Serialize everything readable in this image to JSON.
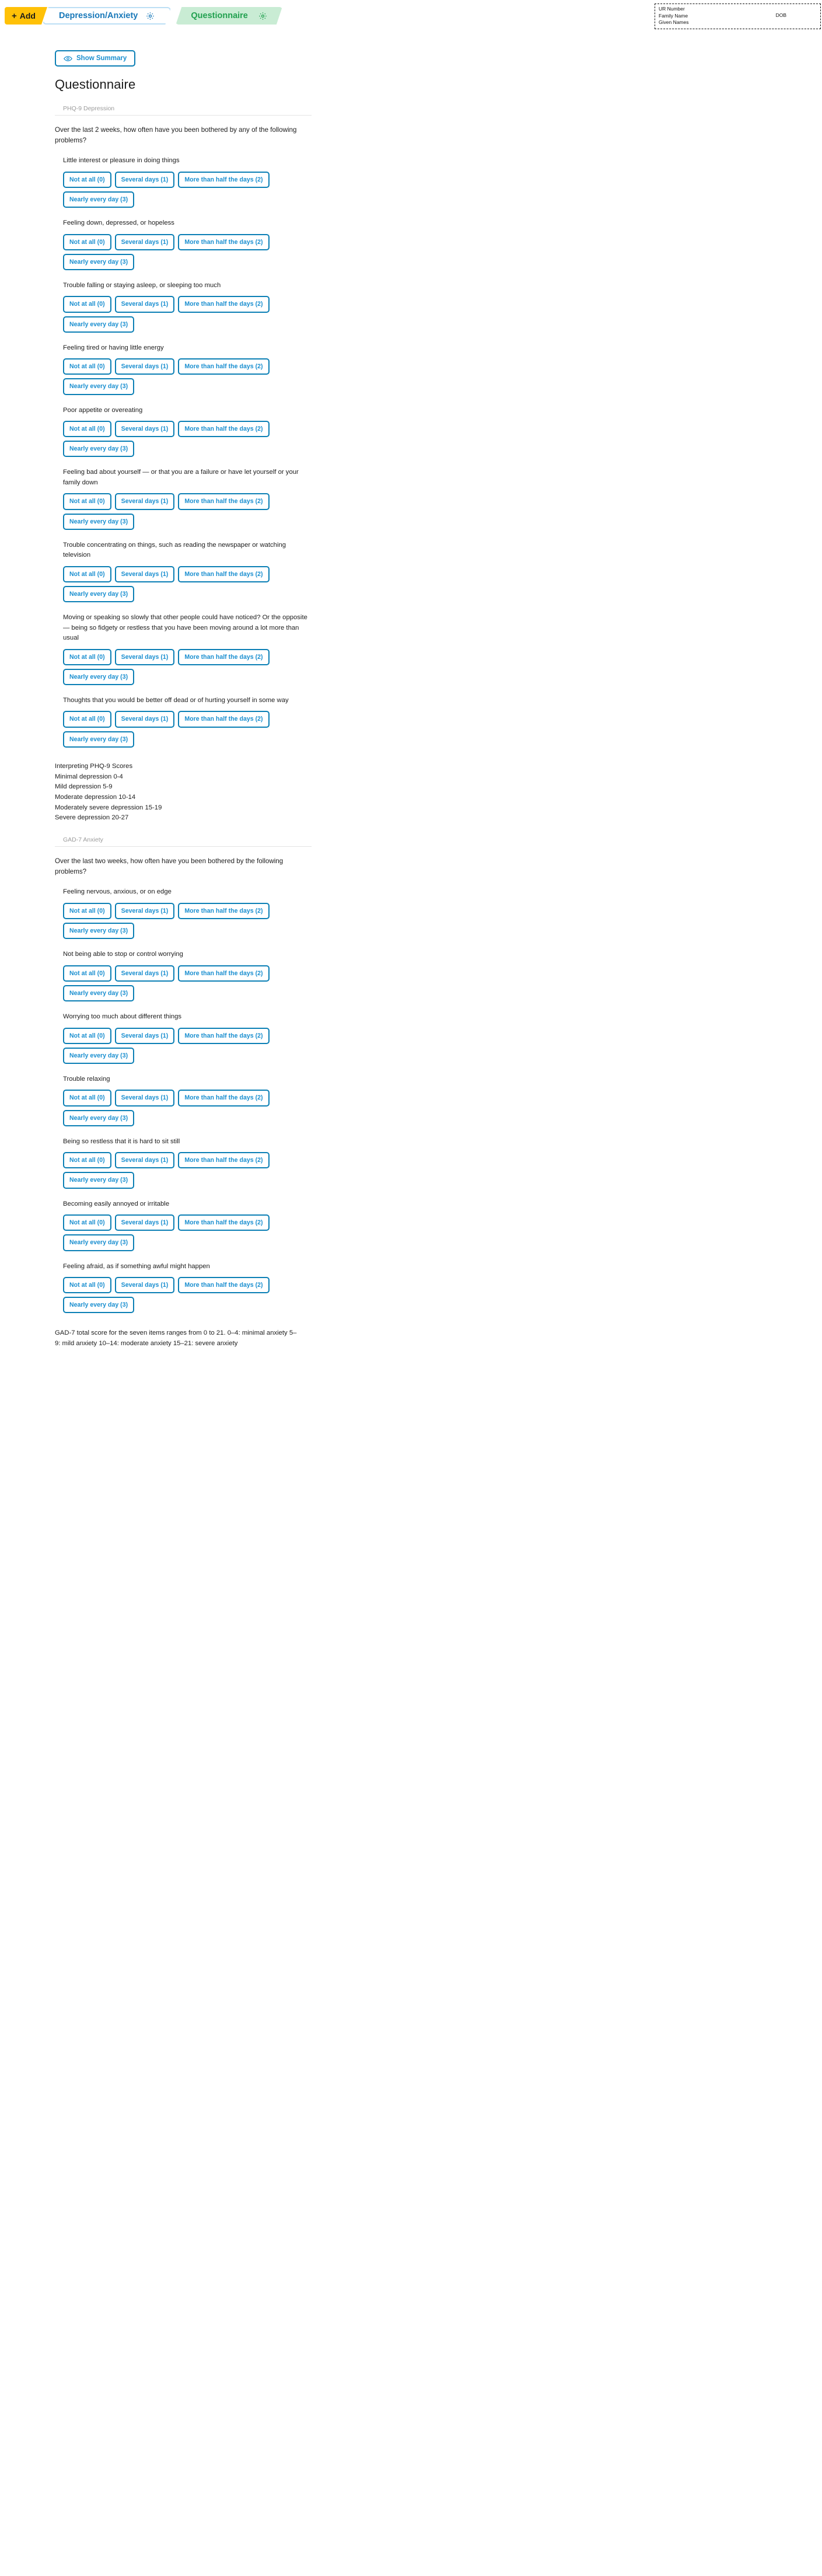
{
  "tabs": [
    {
      "label": "+ Add",
      "name": "add-tab",
      "plus": "+",
      "text": "Add",
      "icon": null
    },
    {
      "label": "Depression/Anxiety",
      "name": "tab-depression-anxiety",
      "icon": "gear-icon"
    },
    {
      "label": "Questionnaire",
      "name": "tab-questionnaire",
      "icon": "gear-icon"
    }
  ],
  "patient_banner": {
    "ur_number": "UR Number",
    "family_name": "Family Name",
    "given_names": "Given Names",
    "dob": "DOB"
  },
  "toolbar": {
    "show_summary_label": "Show Summary",
    "show_summary_icon": "eye-icon"
  },
  "page_title": "Questionnaire",
  "options": {
    "not_at_all": "Not at all (0)",
    "several_days": "Several days (1)",
    "more_than_half": "More than half the days (2)",
    "nearly_every_day": "Nearly every day (3)"
  },
  "phq9": {
    "section_label": "PHQ-9 Depression",
    "intro": "Over the last 2 weeks, how often have you been bothered by any of the following problems?",
    "questions": [
      "Little interest or pleasure in doing things",
      "Feeling down, depressed, or hopeless",
      "Trouble falling or staying asleep, or sleeping too much",
      "Feeling tired or having little energy",
      "Poor appetite or overeating",
      "Feeling bad about yourself — or that you are a failure or have let yourself or your family down",
      "Trouble concentrating on things, such as reading the newspaper or watching television",
      "Moving or speaking so slowly that other people could have noticed? Or the opposite — being so fidgety or restless that you have been moving around a lot more than usual",
      "Thoughts that you would be better off dead or of hurting yourself in some way"
    ],
    "interpretation": [
      "Interpreting PHQ-9 Scores",
      "Minimal depression 0-4",
      "Mild depression 5-9",
      "Moderate depression 10-14",
      "Moderately severe depression 15-19",
      "Severe depression 20-27"
    ]
  },
  "gad7": {
    "section_label": "GAD-7 Anxiety",
    "intro": "Over the last two weeks, how often have you been bothered by the following problems?",
    "questions": [
      "Feeling nervous, anxious, or on edge",
      "Not being able to stop or control worrying",
      "Worrying too much about different things",
      "Trouble relaxing",
      "Being so restless that it is hard to sit still",
      "Becoming easily annoyed or irritable",
      "Feeling afraid, as if something awful might happen"
    ],
    "footnote": "GAD-7 total score for the seven items ranges from 0 to 21. 0–4: minimal anxiety 5–9: mild anxiety 10–14: moderate anxiety 15–21: severe anxiety"
  },
  "colors": {
    "accent_blue": "#1a8fd0",
    "border_blue": "#0b7fb5",
    "tab_yellow": "#ffc107",
    "tab_green_bg": "#c9ecd4",
    "tab_green_text": "#21a04f",
    "muted_grey": "#9b9b9b"
  }
}
